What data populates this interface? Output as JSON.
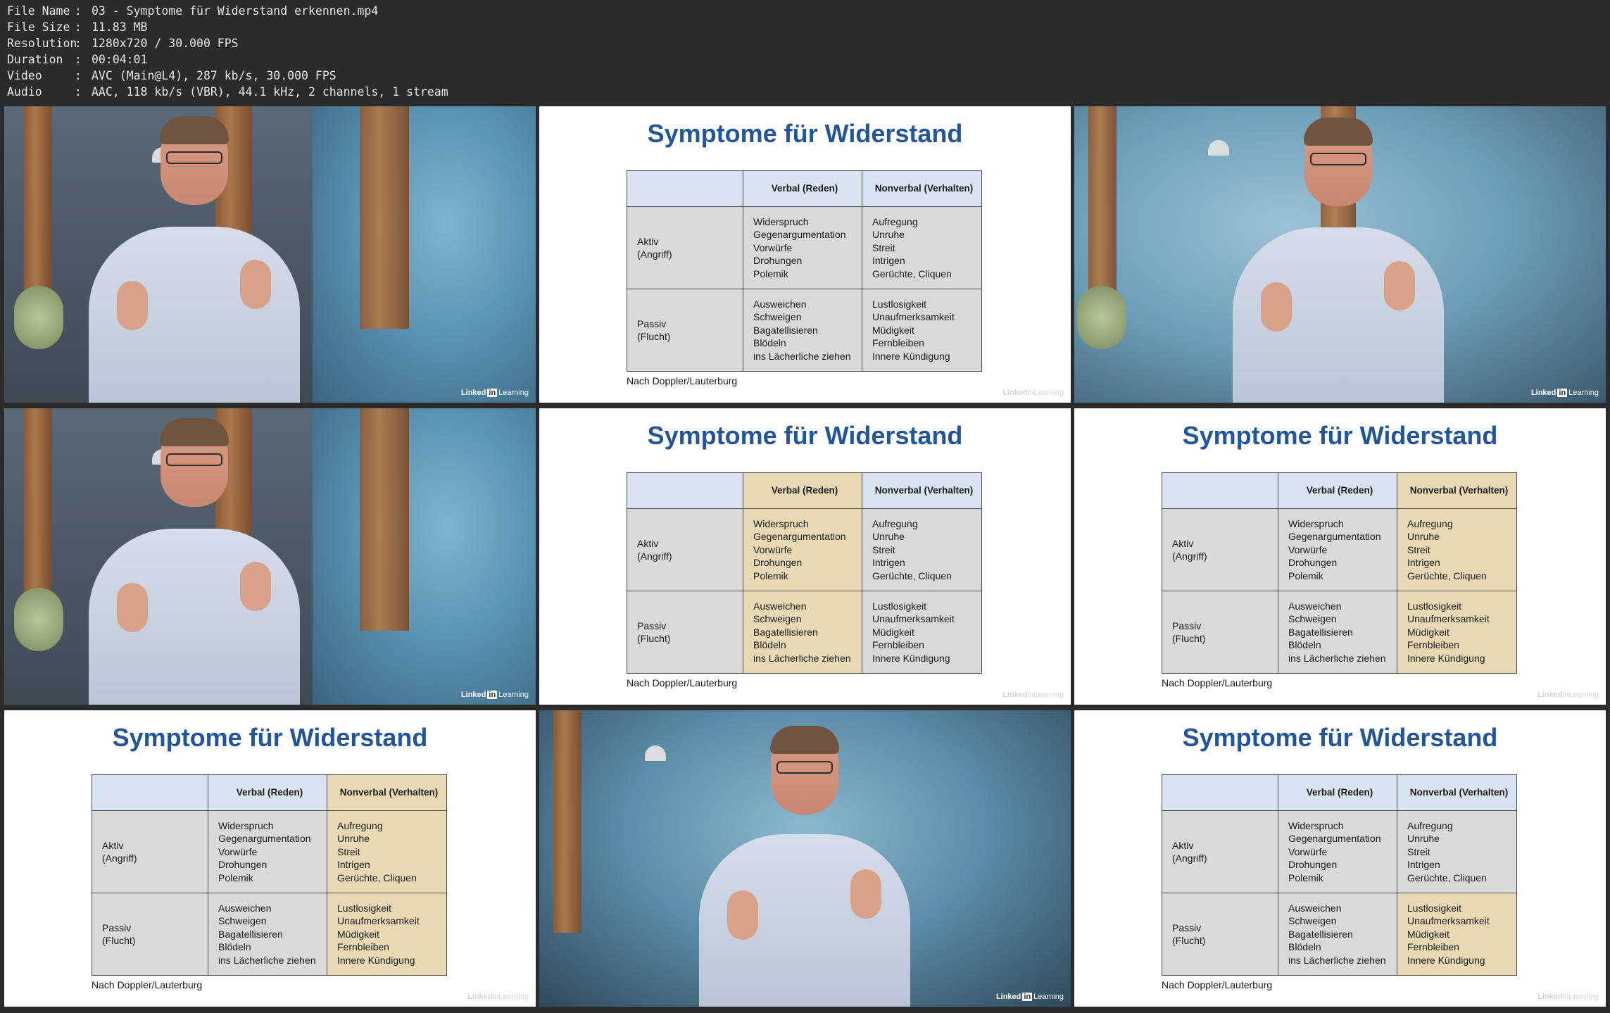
{
  "file_info": [
    {
      "key": "File Name",
      "value": "03 - Symptome für Widerstand erkennen.mp4"
    },
    {
      "key": "File Size",
      "value": "11.83 MB"
    },
    {
      "key": "Resolution",
      "value": "1280x720 / 30.000 FPS"
    },
    {
      "key": "Duration",
      "value": "00:04:01"
    },
    {
      "key": "Video",
      "value": "AVC (Main@L4), 287 kb/s, 30.000 FPS"
    },
    {
      "key": "Audio",
      "value": "AAC, 118 kb/s (VBR), 44.1 kHz, 2 channels, 1 stream"
    }
  ],
  "info_separator": ":",
  "logo": {
    "brand": "Linked",
    "in": "in",
    "suffix": "Learning"
  },
  "slide": {
    "title": "Symptome für Widerstand",
    "headers": [
      "",
      "Verbal (Reden)",
      "Nonverbal (Verhalten)"
    ],
    "rows": [
      {
        "label_lines": [
          "Aktiv",
          "(Angriff)"
        ],
        "verbal": [
          "Widerspruch",
          "Gegenargumentation",
          "Vorwürfe",
          "Drohungen",
          "Polemik"
        ],
        "nonverbal": [
          "Aufregung",
          "Unruhe",
          "Streit",
          "Intrigen",
          "Gerüchte, Cliquen"
        ]
      },
      {
        "label_lines": [
          "Passiv",
          "(Flucht)"
        ],
        "verbal": [
          "Ausweichen",
          "Schweigen",
          "Bagatellisieren",
          "Blödeln",
          "ins Lächerliche ziehen"
        ],
        "nonverbal": [
          "Lustlosigkeit",
          "Unaufmerksamkeit",
          "Müdigkeit",
          "Fernbleiben",
          "Innere Kündigung"
        ]
      }
    ],
    "source": "Nach Doppler/Lauterburg"
  },
  "colors": {
    "title": "#24559a",
    "header_bg": "#d9e4f2",
    "cell_bg": "#d9d9d9",
    "highlight_bg": "#e8d9b4"
  },
  "thumbnails": [
    {
      "type": "video",
      "scene": "left"
    },
    {
      "type": "slide",
      "highlight": "none"
    },
    {
      "type": "video",
      "scene": "right"
    },
    {
      "type": "video",
      "scene": "left"
    },
    {
      "type": "slide",
      "highlight": "verbal-column"
    },
    {
      "type": "slide",
      "highlight": "nonverbal-column"
    },
    {
      "type": "slide",
      "highlight": "nonverbal-column"
    },
    {
      "type": "video",
      "scene": "center"
    },
    {
      "type": "slide",
      "highlight": "nonverbal-passiv"
    }
  ]
}
